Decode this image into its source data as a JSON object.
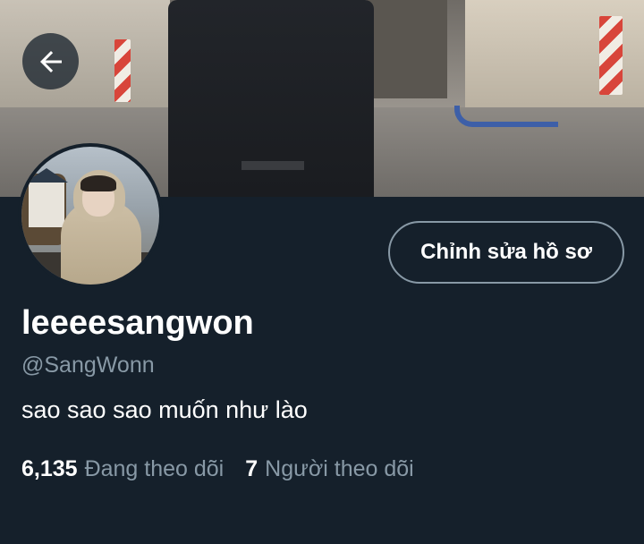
{
  "header": {
    "back_icon": "arrow-left-icon"
  },
  "profile": {
    "display_name": "leeeesangwon",
    "handle": "@SangWonn",
    "bio": "sao sao sao muốn như lào",
    "edit_button_label": "Chỉnh sửa hồ sơ"
  },
  "stats": {
    "following_count": "6,135",
    "following_label": "Đang theo dõi",
    "followers_count": "7",
    "followers_label": "Người theo dõi"
  },
  "colors": {
    "background": "#15202b",
    "secondary_text": "#8899a6",
    "border": "#8899a6",
    "primary_text": "#ffffff"
  }
}
